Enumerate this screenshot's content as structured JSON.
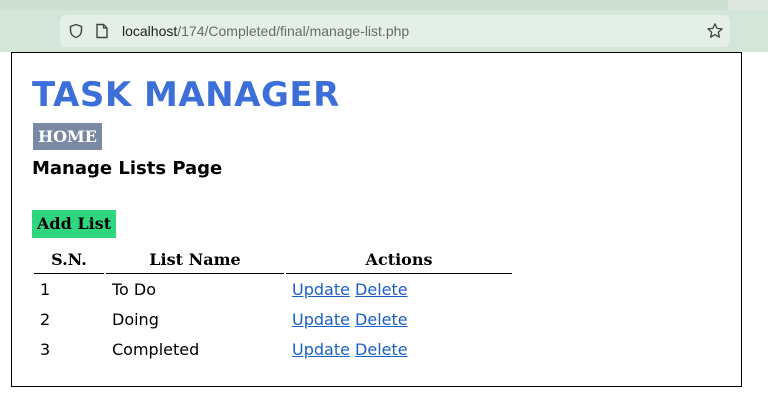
{
  "browser": {
    "url_host": "localhost",
    "url_path": "/174/Completed/final/manage-list.php"
  },
  "app": {
    "title": "TASK MANAGER",
    "nav_home": "HOME",
    "page_heading": "Manage Lists Page",
    "add_button": "Add List"
  },
  "table": {
    "headers": [
      "S.N.",
      "List Name",
      "Actions"
    ],
    "rows": [
      {
        "sn": "1",
        "name": "To Do",
        "update": "Update",
        "delete": "Delete"
      },
      {
        "sn": "2",
        "name": "Doing",
        "update": "Update",
        "delete": "Delete"
      },
      {
        "sn": "3",
        "name": "Completed",
        "update": "Update",
        "delete": "Delete"
      }
    ]
  },
  "colors": {
    "title": "#3d6fd8",
    "home_bg": "#7b8aa4",
    "add_bg": "#2ed67e",
    "link": "#1a5fc4"
  }
}
